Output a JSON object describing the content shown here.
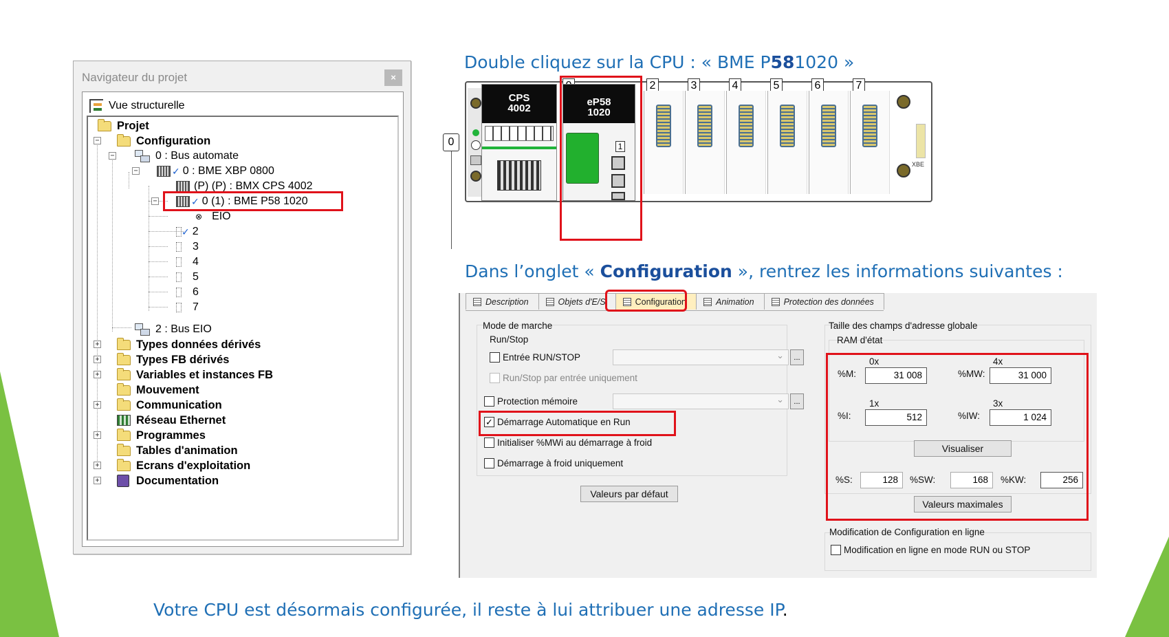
{
  "captions": {
    "top_pre": "Double cliquez sur la CPU : « BME P",
    "top_bold": "58",
    "top_post": "1020 »",
    "mid_pre": "Dans l’onglet « ",
    "mid_bold": "Configuration",
    "mid_post": " », rentrez les informations suivantes :",
    "bottom": "Votre CPU est désormais configurée, il reste à lui attribuer une adresse IP",
    "bottom_period": "."
  },
  "navigator": {
    "title": "Navigateur du projet",
    "close": "×",
    "view_label": "Vue structurelle",
    "tree": {
      "projet": "Projet",
      "configuration": "Configuration",
      "bus_automate": "0 : Bus automate",
      "rack": "0 : BME XBP 0800",
      "cps": "(P) (P) : BMX CPS 4002",
      "cpu": "0 (1) : BME P58 1020",
      "eio": "EIO",
      "slots": [
        "2",
        "3",
        "4",
        "5",
        "6",
        "7"
      ],
      "bus_eio": "2 : Bus EIO",
      "folders": [
        "Types données dérivés",
        "Types FB dérivés",
        "Variables et instances FB",
        "Mouvement",
        "Communication",
        "Réseau Ethernet",
        "Programmes",
        "Tables d'animation",
        "Ecrans d'exploitation",
        "Documentation"
      ]
    }
  },
  "rack": {
    "rack_number": "0",
    "cps_line1": "CPS",
    "cps_line2": "4002",
    "cpu_slot": "0",
    "cpu_line1": "eP58",
    "cpu_line2": "1020",
    "cpu_small": "1",
    "slots": [
      "2",
      "3",
      "4",
      "5",
      "6",
      "7"
    ],
    "xbe": "XBE"
  },
  "dialog": {
    "tabs": [
      "Description",
      "Objets d'E/S",
      "Configuration",
      "Animation",
      "Protection des données"
    ],
    "active_tab": "Configuration",
    "mode_title": "Mode de marche",
    "runstop_title": "Run/Stop",
    "cb_runstop": "Entrée RUN/STOP",
    "cb_runstop_only": "Run/Stop par entrée uniquement",
    "cb_protection": "Protection mémoire",
    "cb_autostart": "Démarrage Automatique en Run",
    "cb_init_mwi": "Initialiser %MWi au démarrage à froid",
    "cb_cold": "Démarrage à froid uniquement",
    "btn_default": "Valeurs par défaut",
    "dots": "...",
    "address_title": "Taille des champs d'adresse globale",
    "ram_title": "RAM d'état",
    "hdr_0x": "0x",
    "hdr_4x": "4x",
    "hdr_1x": "1x",
    "hdr_3x": "3x",
    "m_label": "%M:",
    "m_value": "31 008",
    "mw_label": "%MW:",
    "mw_value": "31 000",
    "i_label": "%I:",
    "i_value": "512",
    "iw_label": "%IW:",
    "iw_value": "1 024",
    "btn_view": "Visualiser",
    "s_label": "%S:",
    "s_value": "128",
    "sw_label": "%SW:",
    "sw_value": "168",
    "kw_label": "%KW:",
    "kw_value": "256",
    "btn_max": "Valeurs maximales",
    "online_title": "Modification de Configuration en ligne",
    "cb_online": "Modification en ligne en mode RUN ou STOP",
    "checked_mark": "✓"
  },
  "colors": {
    "caption_blue": "#1f6fb5",
    "highlight_red": "#e0121a",
    "slide_green": "#7ac142",
    "active_tab": "#ffefbf"
  }
}
